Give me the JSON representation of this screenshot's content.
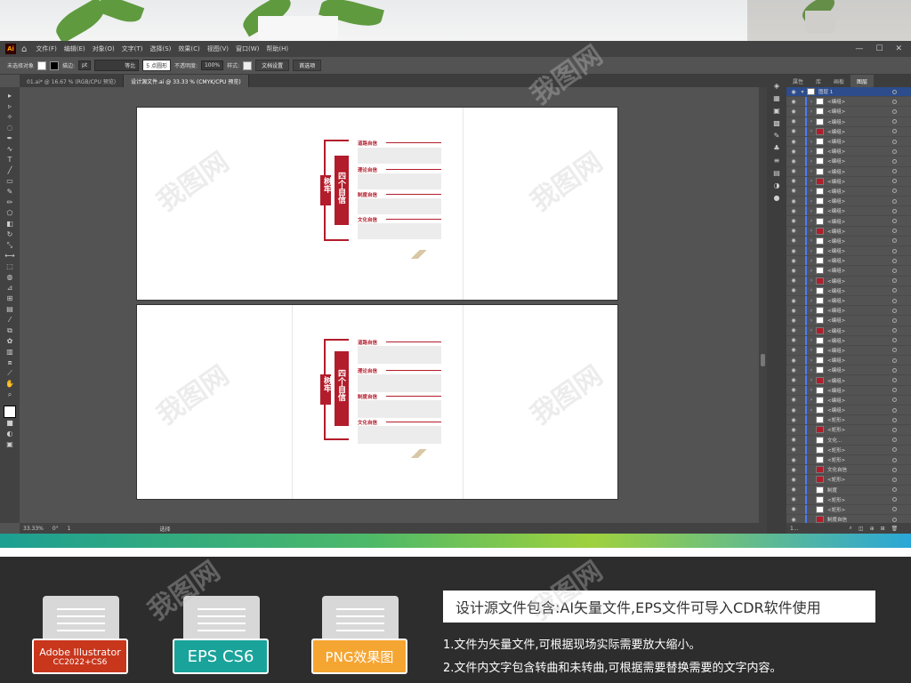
{
  "menubar": {
    "logo": "Ai",
    "items": [
      "文件(F)",
      "编辑(E)",
      "对象(O)",
      "文字(T)",
      "选择(S)",
      "效果(C)",
      "视图(V)",
      "窗口(W)",
      "帮助(H)"
    ]
  },
  "control": {
    "selection": "未选择对象",
    "stroke_label": "描边:",
    "stroke_unit": "pt",
    "stroke_style": "等比",
    "brush": "5 点圆形",
    "opacity_label": "不透明度:",
    "opacity": "100%",
    "style_label": "样式:",
    "doc_setup": "文档设置",
    "preferences": "首选项"
  },
  "tabs": [
    "01.ai* @ 16.67 % (RGB/CPU 预览)",
    "设计源文件.ai @ 33.33 % (CMYK/CPU 预览)"
  ],
  "status": {
    "zoom": "33.33%",
    "angle": "0°",
    "page": "1",
    "mode": "选择"
  },
  "layers_panel": {
    "tabs": [
      "属性",
      "图层",
      "库",
      "画板"
    ],
    "layer_name": "图层 1",
    "items": [
      "<编组>",
      "<编组>",
      "<编组>",
      "<编组>",
      "<编组>",
      "<编组>",
      "<编组>",
      "<编组>",
      "<编组>",
      "<编组>",
      "<编组>",
      "<编组>",
      "<编组>",
      "<编组>",
      "<编组>",
      "<编组>",
      "<编组>",
      "<编组>",
      "<编组>",
      "<编组>",
      "<编组>",
      "<编组>",
      "<编组>",
      "<编组>",
      "<编组>",
      "<编组>",
      "<编组>",
      "<编组>",
      "<编组>",
      "<编组>",
      "<编组>",
      "<编组>",
      "<矩形>",
      "<矩形>",
      "文化...",
      "<矩形>",
      "<矩形>",
      "文化自信",
      "<矩形>",
      "制度",
      "<矩形>",
      "<矩形>",
      "制度自信"
    ],
    "footer": "1..."
  },
  "design": {
    "vertical_main": "四个自信",
    "vertical_side": "树牢",
    "sections": [
      "道路自信",
      "理论自信",
      "制度自信",
      "文化自信"
    ]
  },
  "formats": [
    {
      "label": "Adobe Illustrator",
      "sub": "CC2022+CS6",
      "color": "#c8361c"
    },
    {
      "label": "EPS CS6",
      "sub": "",
      "color": "#1aa39a"
    },
    {
      "label": "PNG效果图",
      "sub": "",
      "color": "#f5a531"
    }
  ],
  "info": {
    "title": "设计源文件包含:AI矢量文件,EPS文件可导入CDR软件使用",
    "line1": "1.文件为矢量文件,可根据现场实际需要放大缩小。",
    "line2": "2.文件内文字包含转曲和未转曲,可根据需要替换需要的文字内容。"
  },
  "watermark": "我图网",
  "colors": {
    "accent": "#b31c2b",
    "frame": "#535353"
  }
}
